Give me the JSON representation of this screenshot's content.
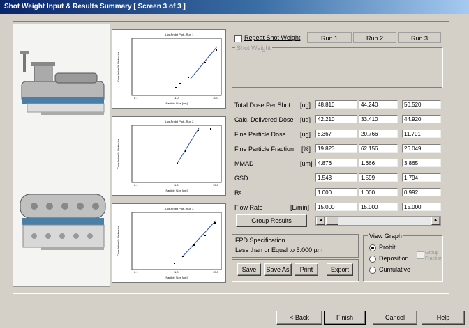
{
  "window": {
    "title": "Shot Weight Input & Results Summary [ Screen 3 of 3 ]"
  },
  "plots": [
    {
      "title": "Log-Probit Plot - Run 1",
      "ylabel": "Cumulative % Undersize",
      "xlabel": "Particle Size [um]",
      "ticks": [
        "0.1",
        "1.0",
        "10.0"
      ]
    },
    {
      "title": "Log-Probit Plot - Run 2",
      "ylabel": "Cumulative % Undersize",
      "xlabel": "Particle Size [um]",
      "ticks": [
        "0.1",
        "1.0",
        "10.0"
      ]
    },
    {
      "title": "Log-Probit Plot - Run 3",
      "ylabel": "Cumulative % Undersize",
      "xlabel": "Particle Size [um]",
      "ticks": [
        "0.1",
        "1.0",
        "10.0"
      ]
    }
  ],
  "repeat_shot_weight": {
    "label": "Repeat Shot Weight",
    "checked": false
  },
  "shot_weight_label": "Shot Weight",
  "runs": [
    "Run 1",
    "Run 2",
    "Run 3"
  ],
  "results": [
    {
      "label": "Total Dose Per Shot",
      "unit": "[ug]",
      "values": [
        "48.810",
        "44.240",
        "50.520"
      ]
    },
    {
      "label": "Calc. Delivered Dose",
      "unit": "[ug]",
      "values": [
        "42.210",
        "33.410",
        "44.920"
      ]
    },
    {
      "label": "Fine Particle Dose",
      "unit": "[ug]",
      "values": [
        "8.367",
        "20.766",
        "11.701"
      ]
    },
    {
      "label": "Fine Particle Fraction",
      "unit": "[%]",
      "values": [
        "19.823",
        "62.156",
        "26.049"
      ]
    },
    {
      "label": "MMAD",
      "unit": "[um]",
      "values": [
        "4.876",
        "1.666",
        "3.865"
      ]
    },
    {
      "label": "GSD",
      "unit": "",
      "values": [
        "1.543",
        "1.599",
        "1.794"
      ]
    },
    {
      "label": "R²",
      "unit": "",
      "values": [
        "1.000",
        "1.000",
        "0.992"
      ]
    },
    {
      "label": "Flow Rate",
      "unit": "[L/min]",
      "values": [
        "15.000",
        "15.000",
        "15.000"
      ]
    }
  ],
  "group_results_label": "Group Results",
  "fpd_spec": {
    "title": "FPD Specification",
    "text": "Less than or Equal to 5.000 µm"
  },
  "view_graph": {
    "title": "View Graph",
    "options": [
      "Probit",
      "Deposition",
      "Cumulative"
    ],
    "selected": "Probit",
    "group_fraction_label": "Group Fraction"
  },
  "actions": {
    "save": "Save",
    "save_as": "Save As",
    "print": "Print",
    "export": "Export"
  },
  "nav": {
    "back": "< Back",
    "finish": "Finish",
    "cancel": "Cancel",
    "help": "Help"
  },
  "scroll": {
    "left": "◄",
    "right": "►"
  }
}
